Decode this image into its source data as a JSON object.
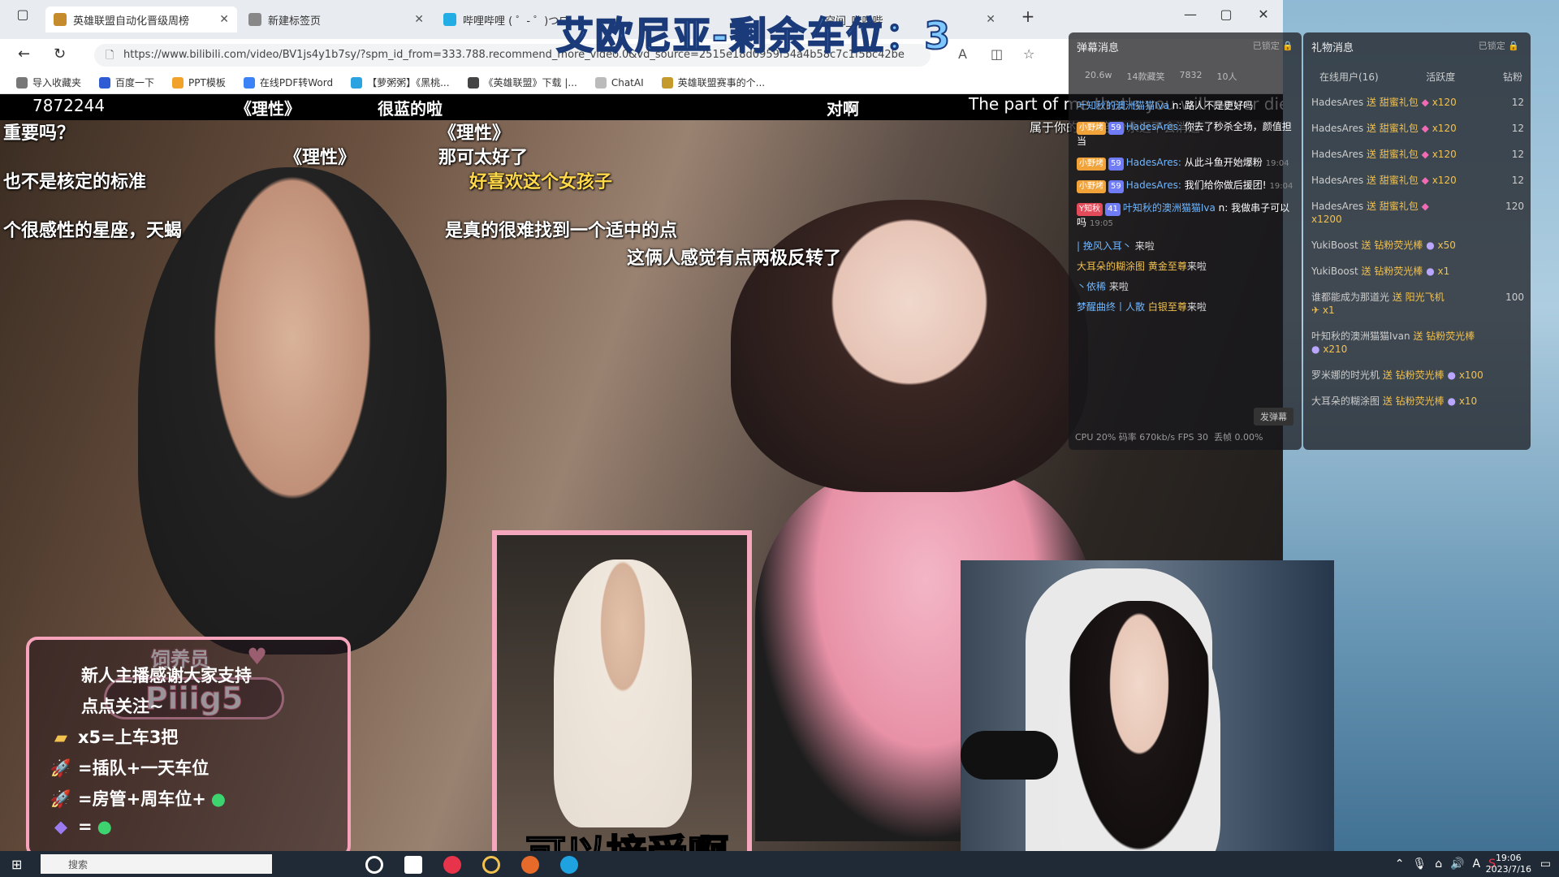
{
  "browser": {
    "tabs": [
      {
        "title": "英雄联盟自动化晋级周榜",
        "active": true
      },
      {
        "title": "新建标签页",
        "active": false
      },
      {
        "title": "哔哩哔哩 ( ゜- ゜)つロ",
        "active": false
      },
      {
        "title": "空间_哔哩哔",
        "active": false
      }
    ],
    "new_tab": "+",
    "url": "https://www.bilibili.com/video/BV1js4y1b7sy/?spm_id_from=333.788.recommend_more_video.0&vd_source=2515e18d0959f54a4b58c7c1f5bc42be",
    "bookmarks": [
      {
        "label": "导入收藏夹",
        "color": "#777"
      },
      {
        "label": "百度一下",
        "color": "#2f5bd5"
      },
      {
        "label": "PPT模板",
        "color": "#f0a22a"
      },
      {
        "label": "在线PDF转Word",
        "color": "#3b82f6"
      },
      {
        "label": "【萝粥粥】《黑桃...",
        "color": "#2aa3e0"
      },
      {
        "label": "《英雄联盟》下载 |...",
        "color": "#444"
      },
      {
        "label": "ChatAI",
        "color": "#999"
      },
      {
        "label": "英雄联盟赛事的个...",
        "color": "#c39a2b"
      }
    ]
  },
  "overlay": {
    "top_banner": "艾欧尼亚-剩余车位：3",
    "view_count": "7872244"
  },
  "subtitles": {
    "top_1": "《理性》",
    "top_2": "很蓝的啦",
    "top_3": "对啊",
    "top_english": "The part of me that's you will never die",
    "line_1": "重要吗？",
    "line_2": "《理性》",
    "line_3": "《理性》",
    "line_4": "那可太好了",
    "line_5": "好喜欢这个女孩子",
    "line_6": "也不是核定的标准",
    "line_7": "个很感性的星座，天蝎",
    "line_8": "是真的很难找到一个适中的点",
    "line_9": "这俩人感觉有点两极反转了",
    "line_10": "属于你的那一部分永远不会消逝",
    "inset_caption": "可以接受啊"
  },
  "streamer": {
    "tag": "饲养员",
    "name": "Piiig5",
    "lines": [
      {
        "icon": "",
        "text": "新人主播感谢大家支持"
      },
      {
        "icon": "",
        "text": "点点关注~"
      },
      {
        "icon": "ticket-icon",
        "text": "x5=上车3把"
      },
      {
        "icon": "rocket-icon",
        "text": "=插队+一天车位"
      },
      {
        "icon": "rocket-red-icon",
        "text": "=房管+周车位+"
      },
      {
        "icon": "gift-icon",
        "text": "="
      }
    ]
  },
  "danmaku": {
    "title": "弹幕消息",
    "locked": "已锁定",
    "stats": [
      "20.6w",
      "14款藏笑",
      "7832"
    ],
    "people": "10人",
    "messages": [
      {
        "badge": "",
        "level": "",
        "user": "叶知秋的澳洲猫猫Iva",
        "text": "n: 路人不是更好吗",
        "time": ""
      },
      {
        "badge": "小野烤",
        "level": "59",
        "user": "HadesAres:",
        "text": "你去了秒杀全场，颜值担当",
        "time": ""
      },
      {
        "badge": "小野烤",
        "level": "59",
        "user": "HadesAres:",
        "text": "从此斗鱼开始爆粉",
        "time": "19:04"
      },
      {
        "badge": "小野烤",
        "level": "59",
        "user": "HadesAres:",
        "text": "我们给你做后援团!",
        "time": "19:04"
      },
      {
        "badge": "Y知秋",
        "level": "41",
        "user": "叶知秋的澳洲猫猫Iva",
        "text": "n: 我做串子可以吗",
        "time": "19:05"
      }
    ],
    "enters": [
      {
        "user": "| 挽风入耳丶",
        "tag": "",
        "text": "来啦"
      },
      {
        "user": "大耳朵的糊涂图",
        "tag": "黄金至尊",
        "text": "来啦"
      },
      {
        "user": "丶依稀",
        "tag": "",
        "text": "来啦"
      },
      {
        "user": "梦醒曲终丨人散",
        "tag": "白银至尊",
        "text": "来啦"
      }
    ],
    "send_button": "发弹幕",
    "footer": "CPU 20%   码率 670kb/s   FPS 30",
    "loss": "丢帧 0.00%"
  },
  "gifts": {
    "title": "礼物消息",
    "locked": "已锁定",
    "tabs": [
      "在线用户(16)",
      "活跃度",
      "钻粉"
    ],
    "items": [
      {
        "user": "HadesAres",
        "action": "送 甜蜜礼包",
        "count": "x120",
        "num": "12"
      },
      {
        "user": "HadesAres",
        "action": "送 甜蜜礼包",
        "count": "x120",
        "num": "12"
      },
      {
        "user": "HadesAres",
        "action": "送 甜蜜礼包",
        "count": "x120",
        "num": "12"
      },
      {
        "user": "HadesAres",
        "action": "送 甜蜜礼包",
        "count": "x120",
        "num": "12"
      },
      {
        "user": "HadesAres",
        "action": "送 甜蜜礼包",
        "count": "x1200",
        "num": "120"
      },
      {
        "user": "YukiBoost",
        "action": "送 钻粉荧光棒",
        "count": "x50",
        "num": ""
      },
      {
        "user": "YukiBoost",
        "action": "送 钻粉荧光棒",
        "count": "x1",
        "num": ""
      },
      {
        "user": "谁都能成为那道光",
        "action": "送 阳光飞机",
        "count": "x1",
        "num": "100"
      },
      {
        "user": "叶知秋的澳洲猫猫Ivan",
        "action": "送 钻粉荧光棒",
        "count": "x210",
        "num": ""
      },
      {
        "user": "罗米娜的时光机",
        "action": "送 钻粉荧光棒",
        "count": "x100",
        "num": ""
      },
      {
        "user": "大耳朵的糊涂图",
        "action": "送 钻粉荧光棒",
        "count": "x10",
        "num": ""
      }
    ]
  },
  "taskbar": {
    "search_placeholder": "搜索",
    "time": "19:06",
    "date": "2023/7/16",
    "ime": "A"
  }
}
